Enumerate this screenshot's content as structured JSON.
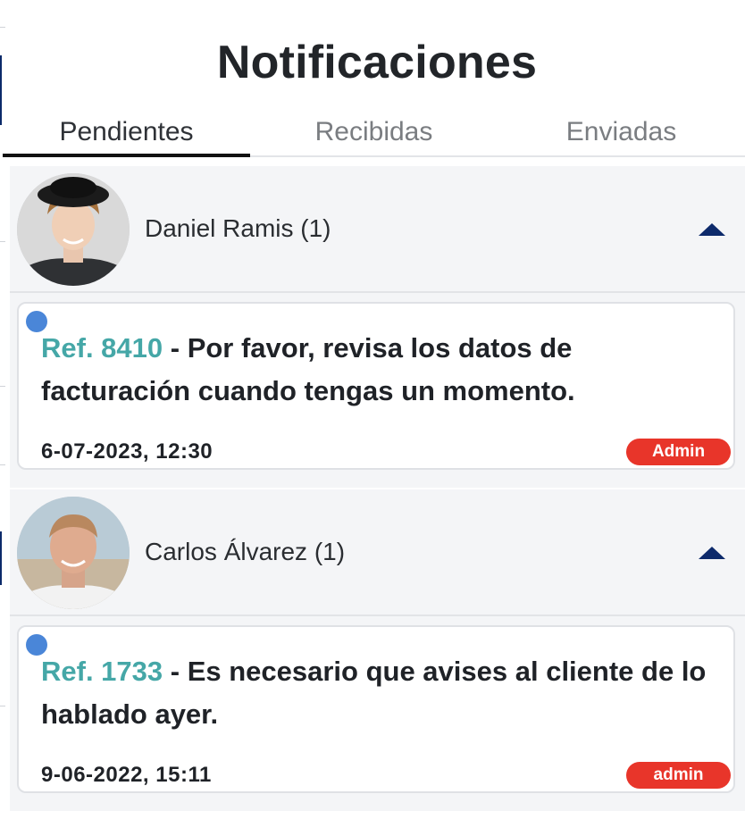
{
  "page": {
    "title": "Notificaciones"
  },
  "tabs": [
    {
      "label": "Pendientes",
      "active": true
    },
    {
      "label": "Recibidas",
      "active": false
    },
    {
      "label": "Enviadas",
      "active": false
    }
  ],
  "groups": [
    {
      "user_name": "Daniel Ramis (1)",
      "expanded": true,
      "notification": {
        "unread": true,
        "ref": "Ref. 8410",
        "message": " - Por favor, revisa los datos de facturación cuando tengas un momento.",
        "date": "6-07-2023, 12:30",
        "badge": "Admin"
      }
    },
    {
      "user_name": "Carlos Álvarez (1)",
      "expanded": true,
      "notification": {
        "unread": true,
        "ref": "Ref. 1733",
        "message": " - Es necesario que avises al cliente de lo hablado ayer.",
        "date": "9-06-2022, 15:11",
        "badge": "admin"
      }
    }
  ],
  "colors": {
    "ref_link": "#45a7a7",
    "badge_bg": "#e8352a",
    "unread_dot": "#4a86d8",
    "chevron": "#0d2a6b",
    "group_bg": "#f4f5f7"
  },
  "icons": {
    "expand_toggle": "chevron-up-icon",
    "unread_indicator": "unread-dot-icon"
  }
}
